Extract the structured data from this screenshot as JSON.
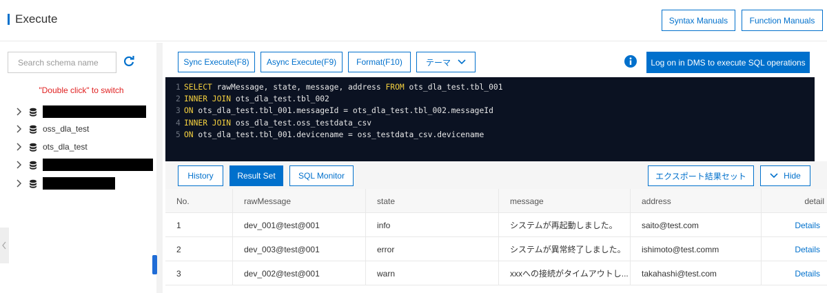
{
  "header": {
    "title": "Execute",
    "syntax_manuals": "Syntax Manuals",
    "function_manuals": "Function Manuals"
  },
  "sidebar": {
    "search_placeholder": "Search schema name",
    "hint": "\"Double click\" to switch",
    "items": [
      {
        "label": "",
        "redacted": true
      },
      {
        "label": "oss_dla_test",
        "redacted": false
      },
      {
        "label": "ots_dla_test",
        "redacted": false
      },
      {
        "label": "",
        "redacted": true
      },
      {
        "label": "",
        "redacted": true
      }
    ]
  },
  "toolbar": {
    "sync_execute": "Sync Execute(F8)",
    "async_execute": "Async Execute(F9)",
    "format": "Format(F10)",
    "theme": "テーマ",
    "dms_login": "Log on in DMS to execute SQL operations"
  },
  "editor": {
    "lines": [
      {
        "no": "1",
        "parts": [
          {
            "t": "SELECT",
            "kw": true
          },
          {
            "t": " rawMessage, state, message, address ",
            "kw": false
          },
          {
            "t": "FROM",
            "kw": true
          },
          {
            "t": " ots_dla_test.tbl_001",
            "kw": false
          }
        ]
      },
      {
        "no": "2",
        "parts": [
          {
            "t": "INNER JOIN",
            "kw": true
          },
          {
            "t": " ots_dla_test.tbl_002",
            "kw": false
          }
        ]
      },
      {
        "no": "3",
        "parts": [
          {
            "t": "ON",
            "kw": true
          },
          {
            "t": " ots_dla_test.tbl_001.messageId = ots_dla_test.tbl_002.messageId",
            "kw": false
          }
        ]
      },
      {
        "no": "4",
        "parts": [
          {
            "t": "INNER JOIN",
            "kw": true
          },
          {
            "t": " oss_dla_test.oss_testdata_csv",
            "kw": false
          }
        ]
      },
      {
        "no": "5",
        "parts": [
          {
            "t": "ON",
            "kw": true
          },
          {
            "t": " ots_dla_test.tbl_001.devicename = oss_testdata_csv.devicename",
            "kw": false
          }
        ]
      }
    ]
  },
  "result_tabs": {
    "history": "History",
    "result_set": "Result Set",
    "sql_monitor": "SQL Monitor",
    "export": "エクスポート結果セット",
    "hide": "Hide"
  },
  "table": {
    "columns": [
      "No.",
      "rawMessage",
      "state",
      "message",
      "address",
      "detail"
    ],
    "rows": [
      {
        "no": "1",
        "raw": "dev_001@test@001",
        "state": "info",
        "message": "システムが再起動しました。",
        "address": "saito@test.com",
        "detail": "Details"
      },
      {
        "no": "2",
        "raw": "dev_003@test@001",
        "state": "error",
        "message": "システムが異常終了しました。",
        "address": "ishimoto@test.comm",
        "detail": "Details"
      },
      {
        "no": "3",
        "raw": "dev_002@test@001",
        "state": "warn",
        "message": "xxxへの接続がタイムアウトし...",
        "address": "takahashi@test.com",
        "detail": "Details"
      }
    ]
  },
  "colors": {
    "primary": "#0070cc",
    "editor_bg": "#0b1222",
    "keyword": "#f4d03f",
    "hint_red": "#e02020"
  }
}
